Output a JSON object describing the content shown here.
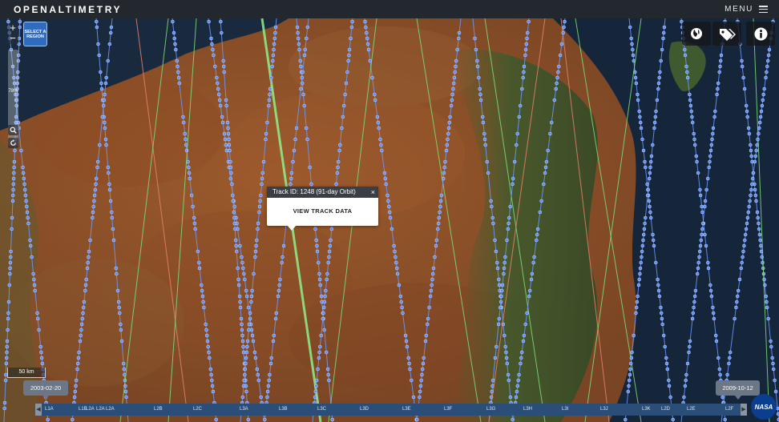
{
  "header": {
    "brand": "OPENALTIMETRY",
    "menu_label": "MENU"
  },
  "map_controls": {
    "zoom_in": "+",
    "zoom_out": "−",
    "zoom_level": "78%",
    "select_region": "SELECT A REGION"
  },
  "top_right_icons": [
    "globe-icon",
    "tags-icon",
    "info-icon"
  ],
  "popup": {
    "title": "Track ID: 1248 (91-day Orbit)",
    "close": "×",
    "action": "VIEW TRACK DATA"
  },
  "scale_bar": "50 km",
  "timeline": {
    "start_date": "2003-02-20",
    "end_date": "2009-10-12",
    "labels": [
      "L1A",
      "L1B",
      "L2A",
      "L2A",
      "L2A",
      "L2B",
      "L2C",
      "L3A",
      "L3B",
      "L3C",
      "L3D",
      "L3E",
      "L3F",
      "L3G",
      "L3H",
      "L3I",
      "L3J",
      "L3K",
      "L2D",
      "L2E",
      "L2F"
    ]
  },
  "logo": "NASA",
  "colors": {
    "header": "#23282e",
    "track_green": "#7ee07a",
    "track_red": "#e8836a",
    "track_point": "#5b8cff",
    "timeline": "#2b4e78",
    "date_badge": "#6b7786"
  }
}
